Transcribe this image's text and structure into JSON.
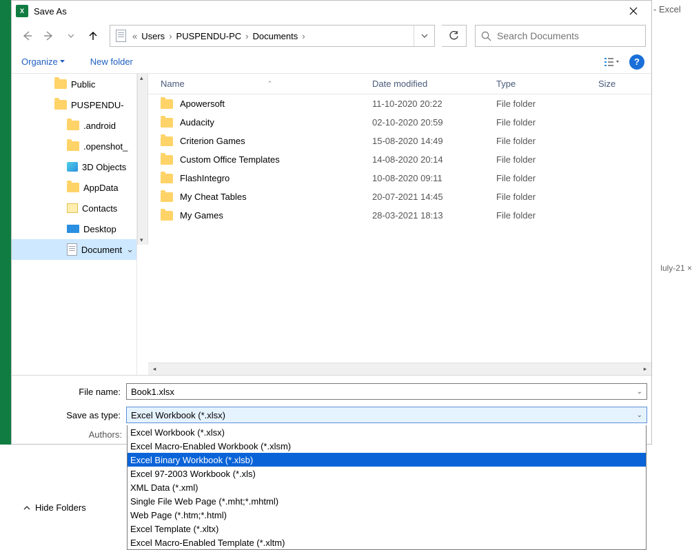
{
  "title": "Save As",
  "bg_right_text": "  - Excel",
  "bg_tab_text": "luly-21 ×",
  "address": {
    "prefix": "«",
    "crumbs": [
      "Users",
      "PUSPENDU-PC",
      "Documents"
    ]
  },
  "search": {
    "placeholder": "Search Documents"
  },
  "toolbar": {
    "organize": "Organize",
    "newfolder": "New folder"
  },
  "tree": [
    {
      "label": "Public",
      "icon": "folder",
      "indent": 62
    },
    {
      "label": "PUSPENDU-",
      "icon": "folder",
      "indent": 62
    },
    {
      "label": ".android",
      "icon": "folder",
      "indent": 80
    },
    {
      "label": ".openshot_",
      "icon": "folder",
      "indent": 80
    },
    {
      "label": "3D Objects",
      "icon": "3d",
      "indent": 80
    },
    {
      "label": "AppData",
      "icon": "folder",
      "indent": 80
    },
    {
      "label": "Contacts",
      "icon": "contacts",
      "indent": 80
    },
    {
      "label": "Desktop",
      "icon": "desktop",
      "indent": 80
    },
    {
      "label": "Document",
      "icon": "doc",
      "indent": 80,
      "selected": true,
      "chevron": true
    }
  ],
  "columns": {
    "name": "Name",
    "date": "Date modified",
    "type": "Type",
    "size": "Size"
  },
  "rows": [
    {
      "name": "Apowersoft",
      "date": "11-10-2020 20:22",
      "type": "File folder"
    },
    {
      "name": "Audacity",
      "date": "02-10-2020 20:59",
      "type": "File folder"
    },
    {
      "name": "Criterion Games",
      "date": "15-08-2020 14:49",
      "type": "File folder"
    },
    {
      "name": "Custom Office Templates",
      "date": "14-08-2020 20:14",
      "type": "File folder"
    },
    {
      "name": "FlashIntegro",
      "date": "10-08-2020 09:11",
      "type": "File folder"
    },
    {
      "name": "My Cheat Tables",
      "date": "20-07-2021 14:45",
      "type": "File folder"
    },
    {
      "name": "My Games",
      "date": "28-03-2021 18:13",
      "type": "File folder"
    }
  ],
  "fields": {
    "filename_label": "File name:",
    "filename_value": "Book1.xlsx",
    "savetype_label": "Save as type:",
    "savetype_value": "Excel Workbook (*.xlsx)",
    "authors_label": "Authors:"
  },
  "dropdown": {
    "selected_index": 2,
    "items": [
      "Excel Workbook (*.xlsx)",
      "Excel Macro-Enabled Workbook (*.xlsm)",
      "Excel Binary Workbook (*.xlsb)",
      "Excel 97-2003 Workbook (*.xls)",
      "XML Data (*.xml)",
      "Single File Web Page (*.mht;*.mhtml)",
      "Web Page (*.htm;*.html)",
      "Excel Template (*.xltx)",
      "Excel Macro-Enabled Template (*.xltm)"
    ]
  },
  "hidefolders": "Hide Folders"
}
